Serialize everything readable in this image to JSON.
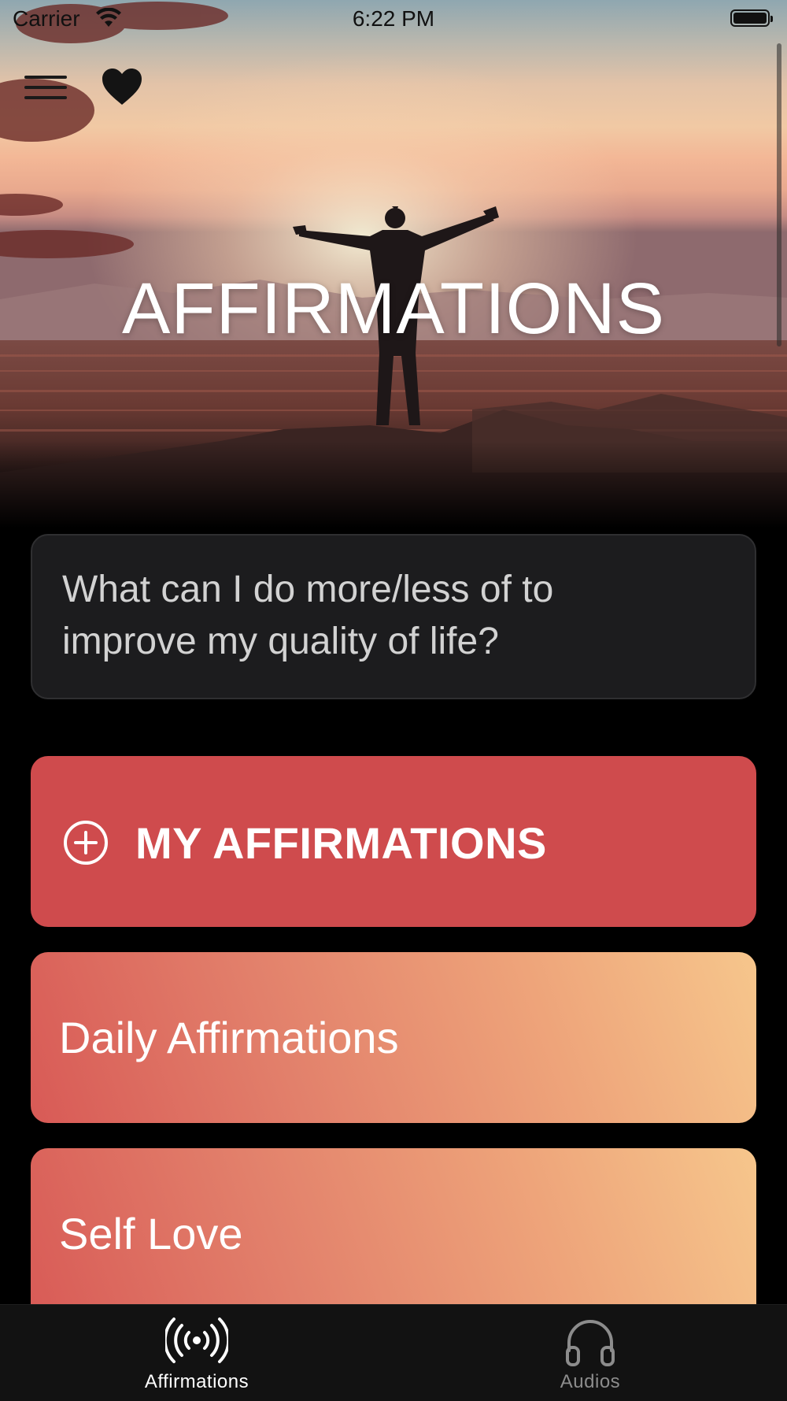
{
  "status_bar": {
    "carrier": "Carrier",
    "time": "6:22 PM"
  },
  "hero": {
    "title": "AFFIRMATIONS"
  },
  "prompt": {
    "line1": "What can I do more/less of to",
    "line2": "improve my quality of life?"
  },
  "my_affirmations": {
    "label": "MY AFFIRMATIONS",
    "icon": "plus-circle-icon",
    "color": "#cf4b4d"
  },
  "categories": [
    {
      "label": "Daily Affirmations"
    },
    {
      "label": "Self Love"
    }
  ],
  "tab_bar": {
    "tabs": [
      {
        "label": "Affirmations",
        "icon": "broadcast-icon",
        "selected": true
      },
      {
        "label": "Audios",
        "icon": "headphones-icon",
        "selected": false
      }
    ]
  },
  "icons": {
    "menu": "hamburger-menu-icon",
    "favorites": "heart-icon"
  }
}
